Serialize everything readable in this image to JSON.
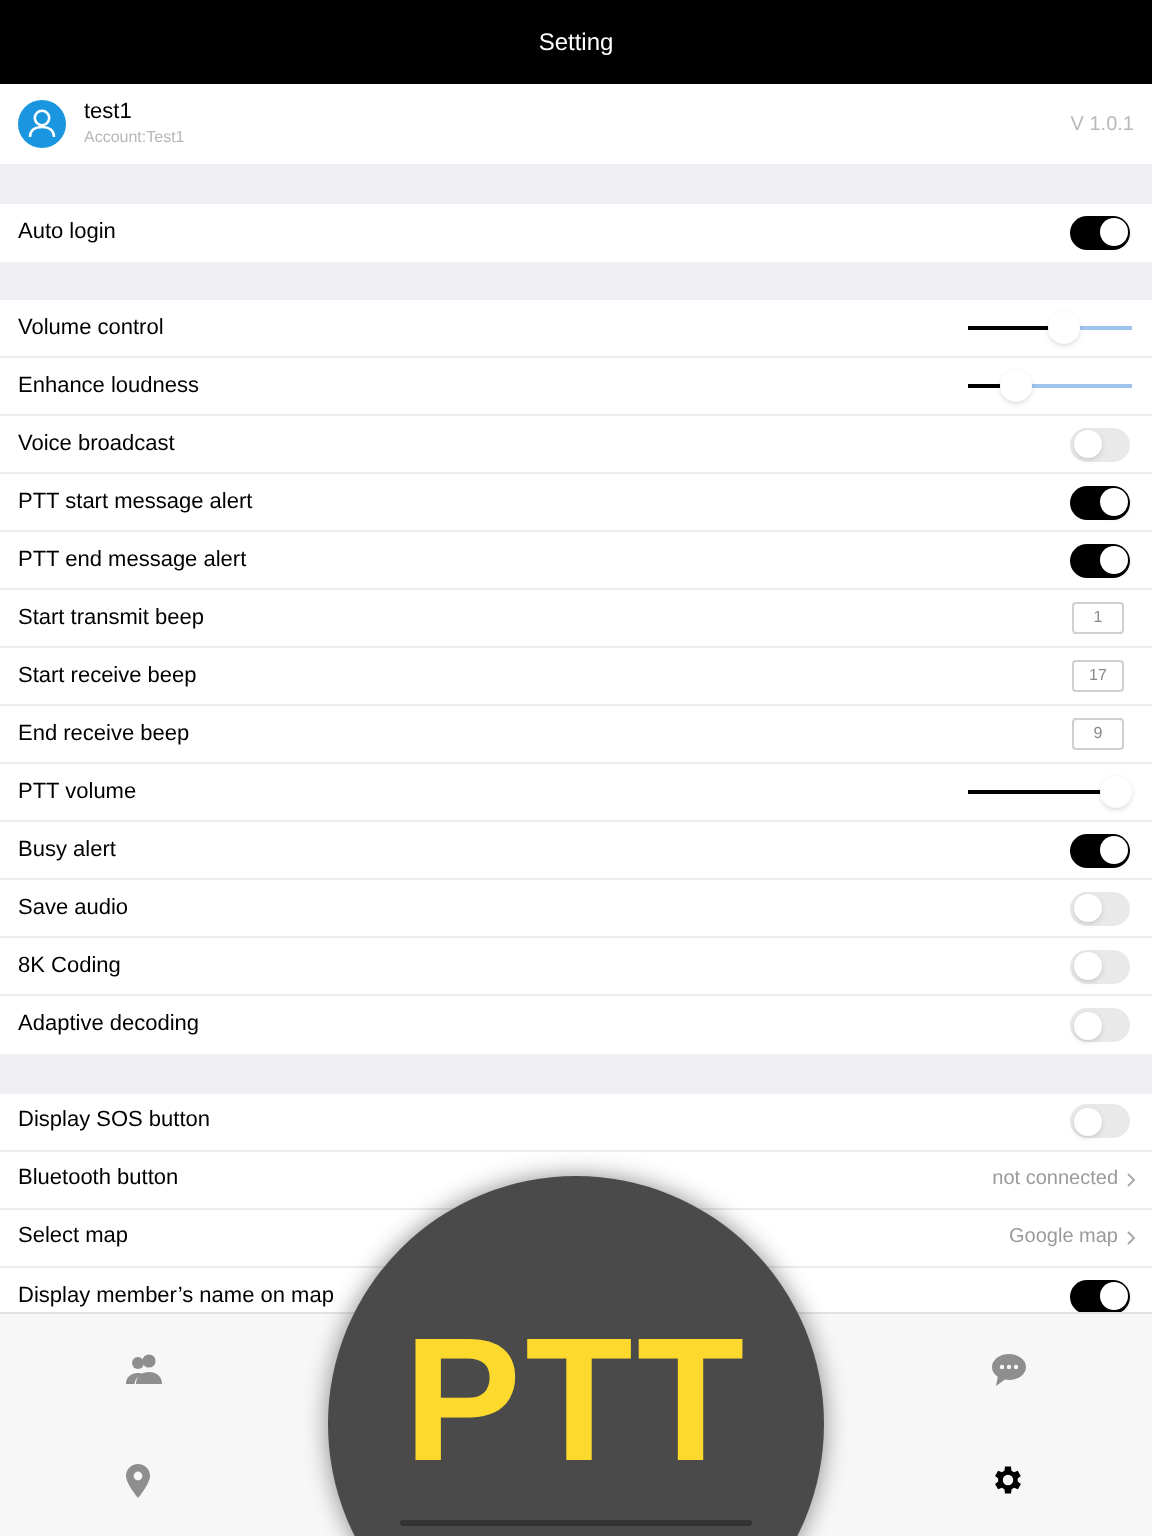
{
  "header": {
    "title": "Setting"
  },
  "account": {
    "name": "test1",
    "account": "Account:Test1",
    "version": "V 1.0.1"
  },
  "sections": [
    {
      "rows": [
        {
          "kind": "toggle",
          "label": "Auto login",
          "on": true
        }
      ]
    },
    {
      "rows": [
        {
          "kind": "slider",
          "label": "Volume control",
          "level": 0.58
        },
        {
          "kind": "slider",
          "label": "Enhance loudness",
          "level": 0.29
        },
        {
          "kind": "toggle",
          "label": "Voice broadcast",
          "on": false
        },
        {
          "kind": "toggle",
          "label": "PTT start message alert",
          "on": true
        },
        {
          "kind": "toggle",
          "label": "PTT end message alert",
          "on": true
        },
        {
          "kind": "number",
          "label": "Start transmit beep",
          "value": "1"
        },
        {
          "kind": "number",
          "label": "Start receive beep",
          "value": "17"
        },
        {
          "kind": "number",
          "label": "End receive beep",
          "value": "9"
        },
        {
          "kind": "slider",
          "label": "PTT volume",
          "level": 0.9
        },
        {
          "kind": "toggle",
          "label": "Busy alert",
          "on": true
        },
        {
          "kind": "toggle",
          "label": "Save audio",
          "on": false
        },
        {
          "kind": "toggle",
          "label": "8K Coding",
          "on": false
        },
        {
          "kind": "toggle",
          "label": "Adaptive decoding",
          "on": false
        }
      ]
    },
    {
      "rows": [
        {
          "kind": "toggle",
          "label": "Display SOS button",
          "on": false
        },
        {
          "kind": "link",
          "label": "Bluetooth button",
          "value": "not connected"
        },
        {
          "kind": "link",
          "label": "Select map",
          "value": "Google map"
        },
        {
          "kind": "toggle",
          "label": "Display member’s name on map",
          "on": true
        }
      ]
    }
  ],
  "tabs": [
    {
      "kind": "contacts",
      "selected": false
    },
    {
      "kind": "messages",
      "selected": false
    },
    {
      "kind": "map",
      "selected": false
    },
    {
      "kind": "settings",
      "selected": true
    }
  ],
  "ptt_button": {
    "label": "PTT"
  }
}
